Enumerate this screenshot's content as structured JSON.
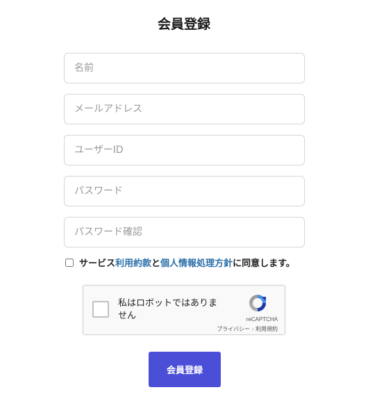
{
  "page": {
    "title": "会員登録"
  },
  "form": {
    "name_placeholder": "名前",
    "email_placeholder": "メールアドレス",
    "userid_placeholder": "ユーザーID",
    "password_placeholder": "パスワード",
    "password_confirm_placeholder": "パスワード確認"
  },
  "agreement": {
    "checked": false,
    "prefix": "サービス",
    "terms_link": "利用約款",
    "connector": "と",
    "privacy_link": "個人情報処理方針",
    "suffix": "に同意します。"
  },
  "recaptcha": {
    "label": "私はロボットではありません",
    "brand": "reCAPTCHA",
    "privacy": "プライバシー",
    "separator": "-",
    "terms": "利用規約",
    "logo_icon": "recaptcha-logo-icon"
  },
  "submit": {
    "label": "会員登録"
  },
  "colors": {
    "accent": "#4b4fd8",
    "link": "#2b6fa8"
  }
}
